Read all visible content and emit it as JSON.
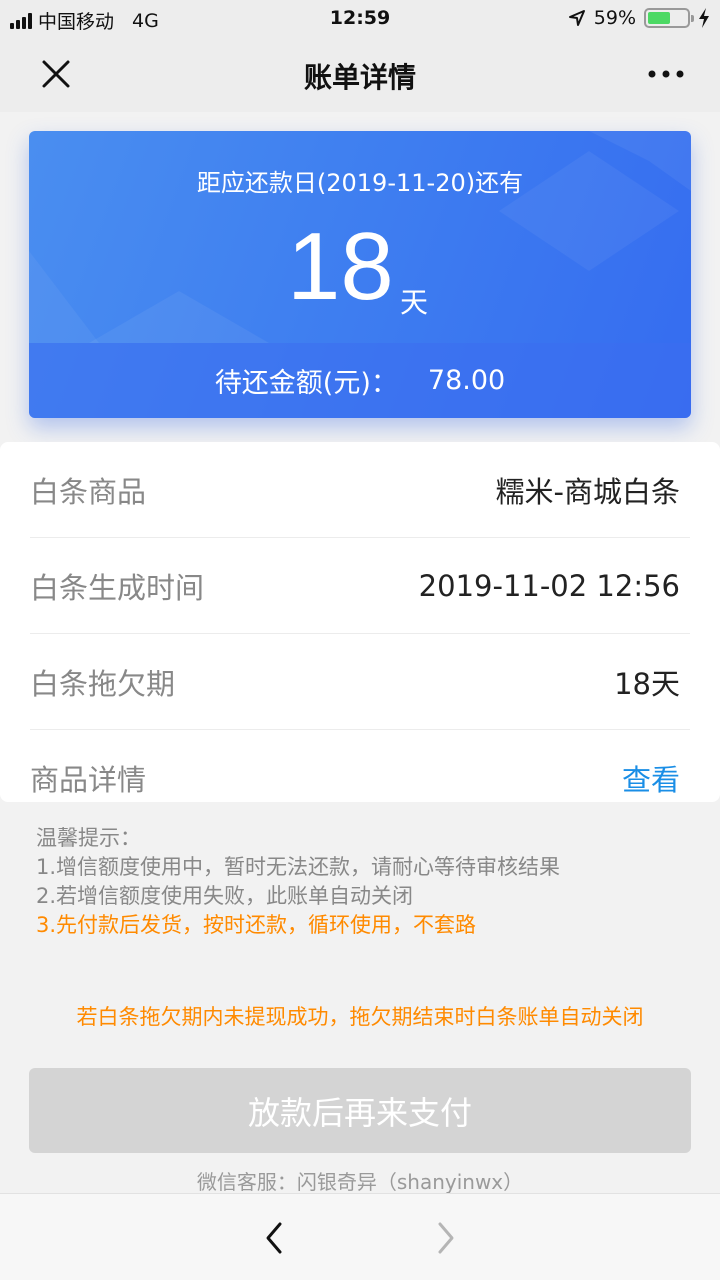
{
  "status_bar": {
    "carrier": "中国移动",
    "network": "4G",
    "time": "12:59",
    "battery_percent_label": "59%",
    "battery_level": 0.59,
    "icons": [
      "signal-icon",
      "location-arrow-icon",
      "battery-icon",
      "charging-bolt-icon"
    ]
  },
  "nav": {
    "title": "账单详情",
    "close_icon": "close-icon",
    "more_icon": "more-dots-icon"
  },
  "card": {
    "subtitle": "距应还款日(2019-11-20)还有",
    "days": "18",
    "days_unit": "天",
    "amount_label": "待还金额(元)：",
    "amount_value": "78.00",
    "colors": {
      "start": "#4a8ef0",
      "end": "#356cf0"
    }
  },
  "details": [
    {
      "label": "白条商品",
      "value": "糯米-商城白条"
    },
    {
      "label": "白条生成时间",
      "value": "2019-11-02 12:56"
    },
    {
      "label": "白条拖欠期",
      "value": "18天"
    },
    {
      "label": "商品详情",
      "value": "查看"
    }
  ],
  "tips": {
    "heading": "温馨提示：",
    "line1": "1.增信额度使用中，暂时无法还款，请耐心等待审核结果",
    "line2": "2.若增信额度使用失败，此账单自动关闭",
    "line3": "3.先付款后发货，按时还款，循环使用，不套路"
  },
  "warning": "若白条拖欠期内未提现成功，拖欠期结束时白条账单自动关闭",
  "pay_button": "放款后再来支付",
  "service": "微信客服：闪银奇异（shanyinwx）",
  "browser": {
    "back_icon": "chevron-left-icon",
    "forward_icon": "chevron-right-icon"
  },
  "colors": {
    "accent_link": "#1a8ee6",
    "warning": "#ff8a00",
    "disabled_button": "#d4d4d4"
  }
}
